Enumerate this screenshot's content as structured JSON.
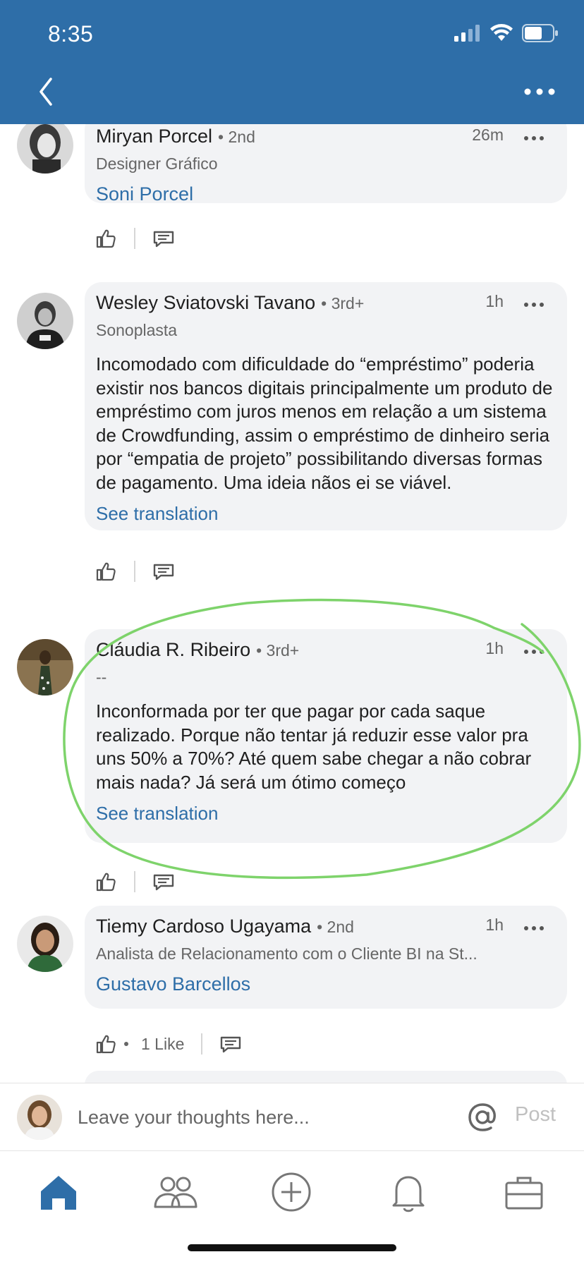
{
  "status_bar": {
    "time": "8:35"
  },
  "header": {
    "back_icon": "chevron-left-icon",
    "more_icon": "more-dots-icon"
  },
  "comments": [
    {
      "author": "Miryan Porcel",
      "degree": "• 2nd",
      "headline": "Designer Gráfico",
      "time": "26m",
      "mention": "Soni Porcel",
      "text": "",
      "see_translation": ""
    },
    {
      "author": "Wesley Sviatovski Tavano",
      "degree": "• 3rd+",
      "headline": "Sonoplasta",
      "time": "1h",
      "text": "Incomodado com dificuldade do “empréstimo” poderia existir nos bancos digitais principalmente um produto de empréstimo com juros menos em relação a um sistema de Crowdfunding, assim o empréstimo de dinheiro seria por “empatia de projeto” possibilitando diversas formas de pagamento. Uma ideia nãos ei se viável.",
      "see_translation": "See translation"
    },
    {
      "author": "Cláudia R. Ribeiro",
      "degree": "• 3rd+",
      "headline": "--",
      "time": "1h",
      "text": "Inconformada por ter que pagar por cada saque realizado. Porque não tentar já reduzir esse valor pra uns 50% a 70%? Até quem sabe chegar a não cobrar mais nada? Já será um ótimo começo",
      "see_translation": "See translation"
    },
    {
      "author": "Tiemy Cardoso Ugayama",
      "degree": "• 2nd",
      "headline": "Analista de Relacionamento com o Cliente BI na St...",
      "time": "1h",
      "mention": "Gustavo Barcellos",
      "like_count": "1 Like"
    }
  ],
  "composer": {
    "placeholder": "Leave your thoughts here...",
    "post_label": "Post"
  },
  "tabs": [
    {
      "icon": "home-icon",
      "active": true
    },
    {
      "icon": "my-network-icon"
    },
    {
      "icon": "post-plus-icon"
    },
    {
      "icon": "notifications-bell-icon"
    },
    {
      "icon": "jobs-briefcase-icon"
    }
  ],
  "colors": {
    "brand": "#2e6ea8",
    "bubble": "#f2f3f5",
    "annotation": "#7ed36b"
  }
}
